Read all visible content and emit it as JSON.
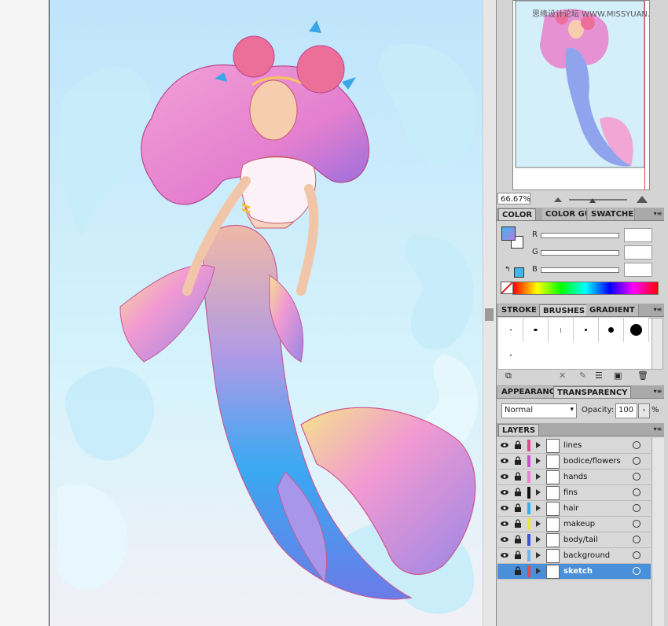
{
  "watermark": "思缘设计论坛 WWW.MISSYUAN.COM",
  "navigator": {
    "zoom": "66.67%"
  },
  "color_panel": {
    "tabs": [
      "COLOR",
      "COLOR GU",
      "SWATCHES"
    ],
    "channels": [
      "R",
      "G",
      "B"
    ],
    "fill_color": "#3fb6ec"
  },
  "brush_panel": {
    "tabs": [
      "STROKE",
      "BRUSHES",
      "GRADIENT"
    ]
  },
  "transparency_panel": {
    "tabs": [
      "APPEARANCE",
      "TRANSPARENCY"
    ],
    "blend_mode": "Normal",
    "opacity_label": "Opacity:",
    "opacity_value": "100",
    "opacity_unit": "%"
  },
  "layers_panel": {
    "title": "LAYERS",
    "layers": [
      {
        "name": "lines",
        "color": "#e2488a"
      },
      {
        "name": "bodice/flowers",
        "color": "#d14bd9"
      },
      {
        "name": "hands",
        "color": "#ef7fd6"
      },
      {
        "name": "fins",
        "color": "#111111"
      },
      {
        "name": "hair",
        "color": "#2fb1ef"
      },
      {
        "name": "makeup",
        "color": "#e8e83c"
      },
      {
        "name": "body/tail",
        "color": "#3e54d9"
      },
      {
        "name": "background",
        "color": "#6fb5f2"
      },
      {
        "name": "sketch",
        "color": "#e54a4a"
      }
    ]
  }
}
